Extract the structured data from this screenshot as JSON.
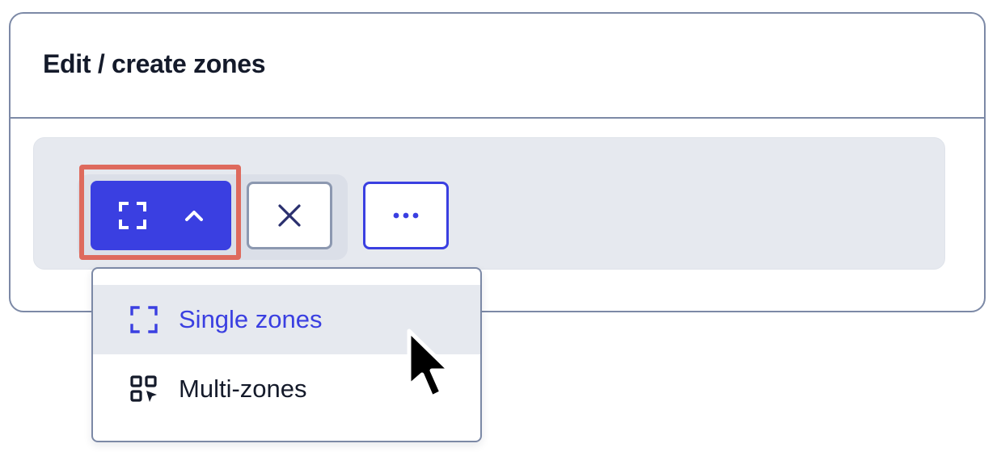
{
  "panel": {
    "title": "Edit / create zones"
  },
  "toolbar": {
    "zone_button": {
      "icon": "zone-frame-icon",
      "caret_icon": "chevron-up-icon",
      "state": "expanded"
    },
    "close_button": {
      "icon": "close-icon"
    },
    "more_button": {
      "icon": "more-horizontal-icon"
    }
  },
  "dropdown": {
    "items": [
      {
        "label": "Single zones",
        "icon": "zone-frame-icon",
        "active": true
      },
      {
        "label": "Multi-zones",
        "icon": "multi-zones-icon",
        "active": false
      }
    ]
  },
  "colors": {
    "accent": "#3a3fe1",
    "highlight": "#de6a5d",
    "border": "#7c89a6",
    "toolbar_bg": "#e6e9ef",
    "text": "#141a2a"
  }
}
